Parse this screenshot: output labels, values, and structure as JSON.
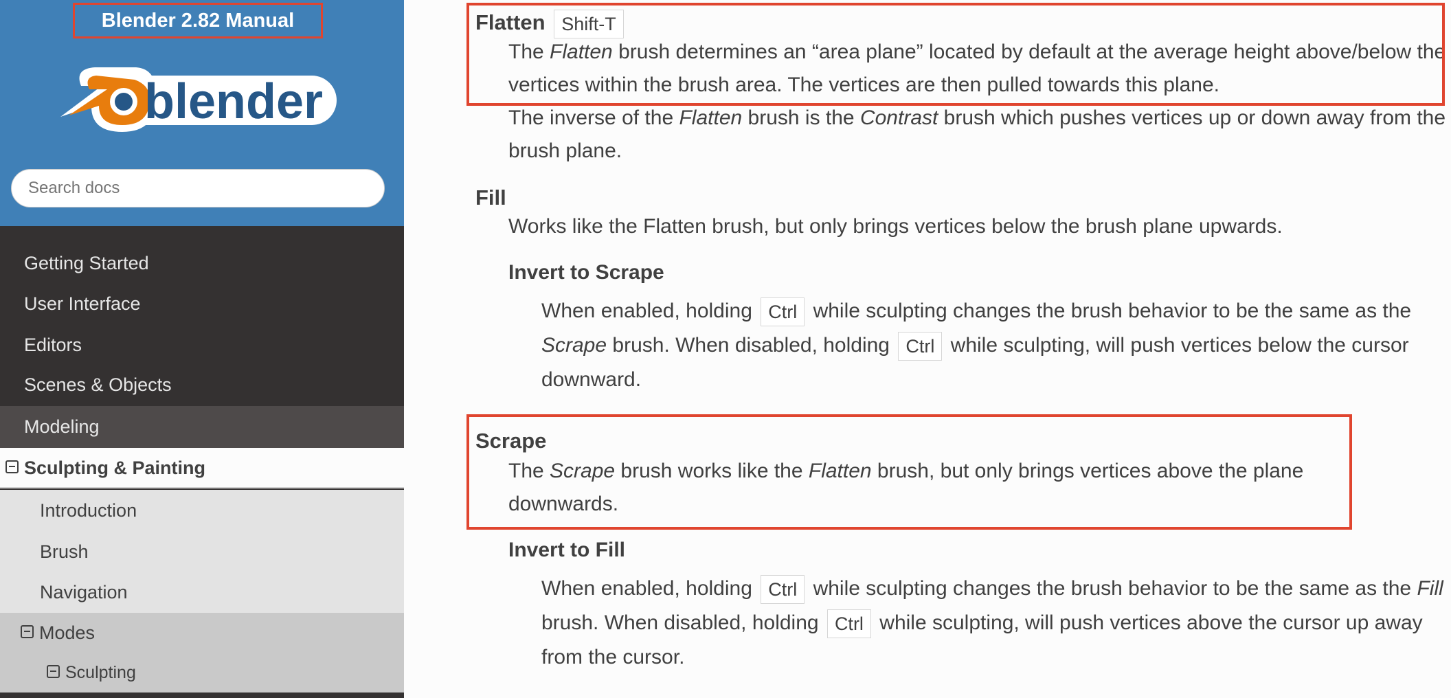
{
  "sidebar": {
    "manual_title": "Blender 2.82 Manual",
    "logo_text": "blender",
    "search_placeholder": "Search docs",
    "nav": [
      {
        "label": "Getting Started",
        "level": 0
      },
      {
        "label": "User Interface",
        "level": 0
      },
      {
        "label": "Editors",
        "level": 0
      },
      {
        "label": "Scenes & Objects",
        "level": 0
      },
      {
        "label": "Modeling",
        "level": 0
      },
      {
        "label": "Sculpting & Painting",
        "level": 1,
        "expanded": true
      },
      {
        "label": "Introduction",
        "level": 2
      },
      {
        "label": "Brush",
        "level": 2
      },
      {
        "label": "Navigation",
        "level": 2
      },
      {
        "label": "Modes",
        "level": 2,
        "expanded": true
      },
      {
        "label": "Sculpting",
        "level": 3,
        "expanded": true
      }
    ]
  },
  "content": {
    "flatten": {
      "term": "Flatten",
      "shortcut": "Shift-T",
      "p1": [
        "The ",
        "Flatten",
        " brush determines an “area plane” located by default at the average height above/below the vertices within the brush area. The vertices are then pulled towards this plane."
      ],
      "p2": [
        "The inverse of the ",
        "Flatten",
        " brush is the ",
        "Contrast",
        " brush which pushes vertices up or down away from the brush plane."
      ]
    },
    "fill": {
      "term": "Fill",
      "desc": "Works like the Flatten brush, but only brings vertices below the brush plane upwards.",
      "option_term": "Invert to Scrape",
      "option_desc": [
        "When enabled, holding ",
        "Ctrl",
        " while sculpting changes the brush behavior to be the same as the ",
        "Scrape",
        " brush. When disabled, holding ",
        "Ctrl",
        " while sculpting, will push vertices below the cursor downward."
      ]
    },
    "scrape": {
      "term": "Scrape",
      "desc": [
        "The ",
        "Scrape",
        " brush works like the ",
        "Flatten",
        " brush, but only brings vertices above the plane downwards."
      ],
      "option_term": "Invert to Fill",
      "option_desc": [
        "When enabled, holding ",
        "Ctrl",
        " while sculpting changes the brush behavior to be the same as the ",
        "Fill",
        " brush. When disabled, holding ",
        "Ctrl",
        " while sculpting, will push vertices above the cursor up away from the cursor."
      ]
    }
  },
  "colors": {
    "header_blue": "#4080b7",
    "nav_dark": "#343131",
    "highlight_red": "#e0452f",
    "blender_orange": "#e87d0d",
    "blender_blue": "#265787"
  }
}
